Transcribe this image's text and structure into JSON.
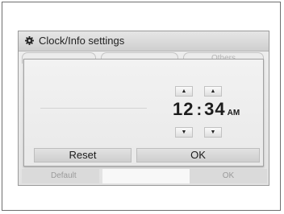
{
  "window": {
    "title": "Clock/Info settings"
  },
  "background": {
    "tabs": [
      "",
      "",
      "Others"
    ],
    "default_label": "Default",
    "ok_label": "OK"
  },
  "dialog": {
    "hour": "12",
    "separator": ":",
    "minute": "34",
    "ampm": "AM",
    "up_arrow": "▲",
    "down_arrow": "▼",
    "reset_label": "Reset",
    "ok_label": "OK"
  },
  "icons": {
    "title_icon": "gear-icon"
  },
  "colors": {
    "frame_border": "#6e6e6e",
    "panel_bg": "#e6e6e6",
    "button_bg": "#d8d8d8",
    "text": "#1c1c1c"
  }
}
